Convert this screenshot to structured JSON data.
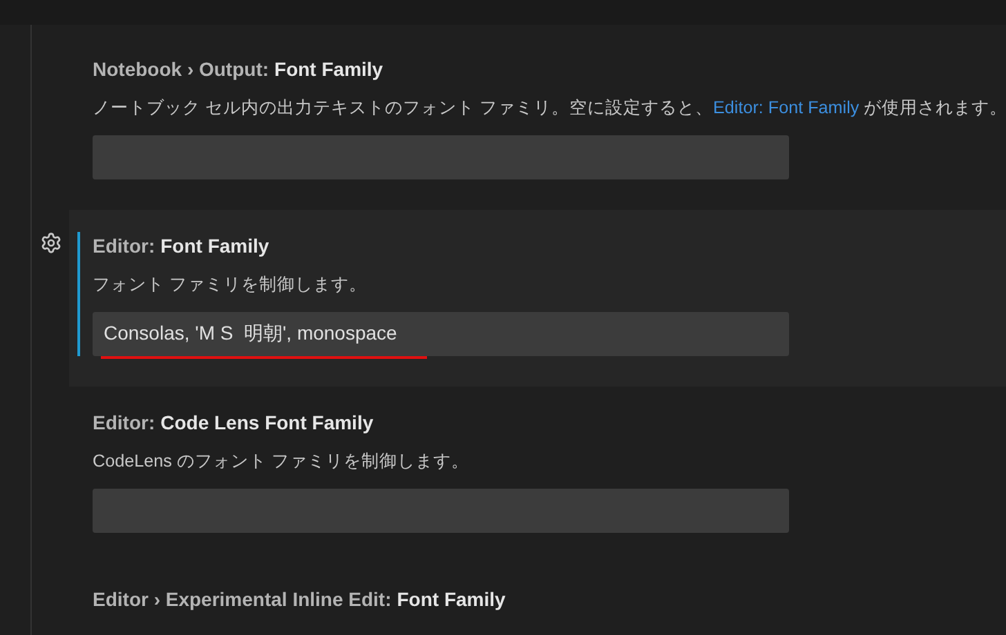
{
  "settings": [
    {
      "category": "Notebook › Output:",
      "name": "Font Family",
      "description": [
        {
          "kind": "text",
          "text": "ノートブック セル内の出力テキストのフォント ファミリ。空に設定すると、"
        },
        {
          "kind": "link",
          "text": "Editor: Font Family"
        },
        {
          "kind": "text",
          "text": " が使用されます。"
        }
      ],
      "field": {
        "underlined": false
      },
      "focused": false
    },
    {
      "category": "Editor:",
      "name": "Font Family",
      "description": [
        {
          "kind": "text",
          "text": "フォント ファミリを制御します。"
        }
      ],
      "field": {
        "value": "Consolas, 'M S  明朝', monospace",
        "underlined": true
      },
      "focused": true
    },
    {
      "category": "Editor:",
      "name": "Code Lens Font Family",
      "description": [
        {
          "kind": "text",
          "text": "CodeLens のフォント ファミリを制御します。"
        }
      ],
      "field": {
        "underlined": false
      },
      "focused": false
    },
    {
      "category": "Editor › Experimental Inline Edit:",
      "name": "Font Family",
      "focused": false
    }
  ]
}
